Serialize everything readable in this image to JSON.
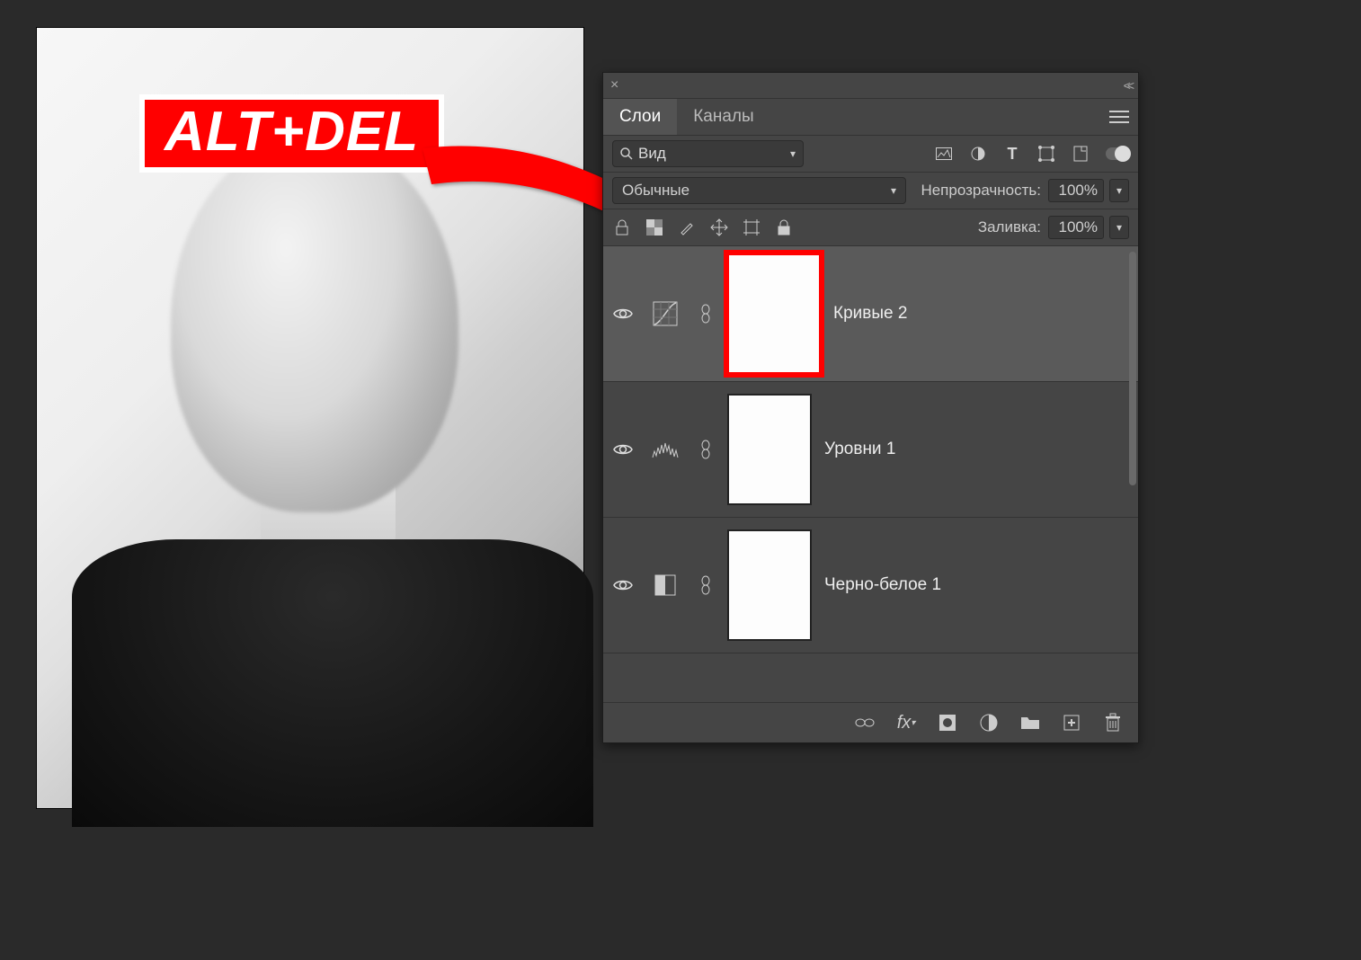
{
  "badge_text": "ALT+DEL",
  "panel": {
    "tabs": [
      "Слои",
      "Каналы"
    ],
    "active_tab_index": 0,
    "search": {
      "placeholder": "Вид"
    },
    "blend_mode": "Обычные",
    "opacity": {
      "label": "Непрозрачность:",
      "value": "100%"
    },
    "fill": {
      "label": "Заливка:",
      "value": "100%"
    },
    "layers": [
      {
        "name": "Кривые 2",
        "adj_icon": "curves",
        "selected": true,
        "highlight_mask": true
      },
      {
        "name": "Уровни 1",
        "adj_icon": "levels",
        "selected": false,
        "highlight_mask": false
      },
      {
        "name": "Черно-белое 1",
        "adj_icon": "bw",
        "selected": false,
        "highlight_mask": false
      }
    ]
  }
}
